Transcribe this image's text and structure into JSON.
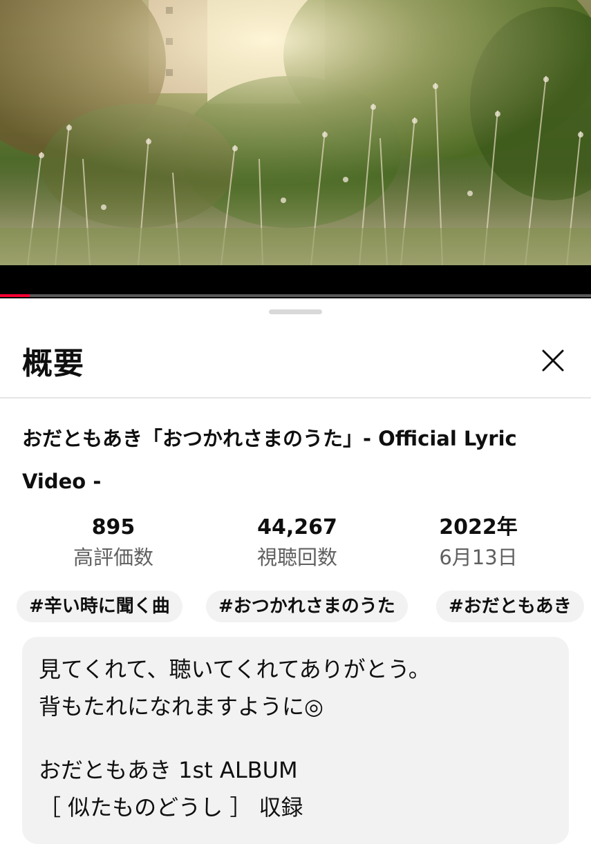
{
  "player": {
    "progress_fraction": 0.05
  },
  "sheet": {
    "title": "概要",
    "close_icon": "close-icon"
  },
  "video": {
    "title": "おだともあき「おつかれさまのうた」- Official Lyric Video -"
  },
  "stats": [
    {
      "value": "895",
      "label": "高評価数"
    },
    {
      "value": "44,267",
      "label": "視聴回数"
    },
    {
      "value": "2022年",
      "label": "6月13日"
    }
  ],
  "hashtags": [
    "#辛い時に聞く曲",
    "#おつかれさまのうた",
    "#おだともあき"
  ],
  "description": {
    "lines": [
      "見てくれて、聴いてくれてありがとう。",
      "背もたれになれますように◎",
      "",
      "おだともあき 1st ALBUM",
      "［ 似たものどうし ］ 収録"
    ]
  }
}
